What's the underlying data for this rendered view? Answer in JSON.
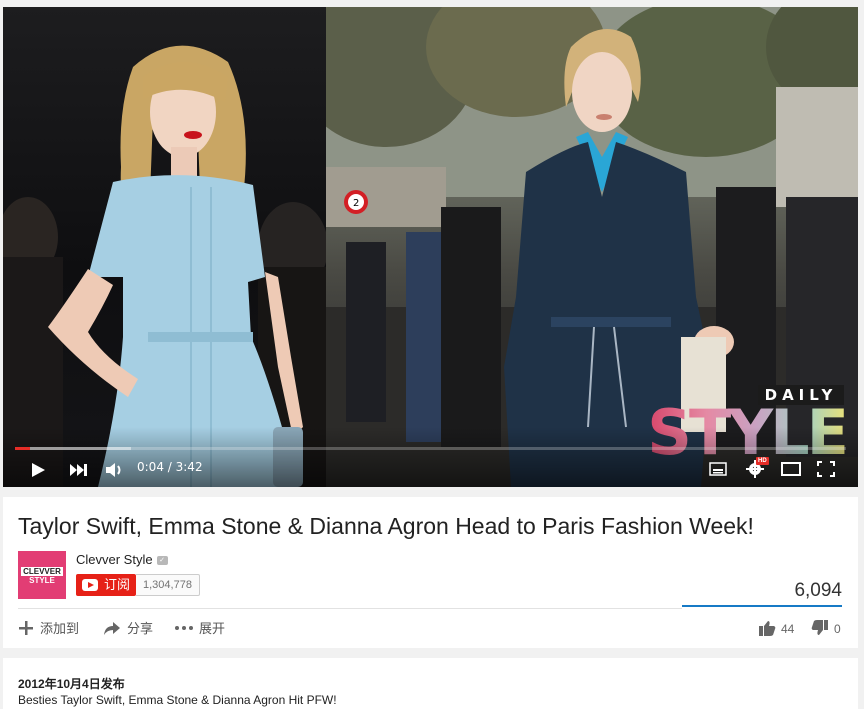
{
  "video": {
    "current_time": "0:04",
    "separator": " / ",
    "duration": "3:42",
    "played_fraction": 0.018,
    "loaded_fraction": 0.14,
    "hd_badge": "HD",
    "watermark": {
      "daily": "DAILY",
      "style": "STYLE"
    },
    "sign_text": "2"
  },
  "info": {
    "title": "Taylor Swift, Emma Stone & Dianna Agron Head to Paris Fashion Week!",
    "channel": {
      "name": "Clevver Style",
      "avatar_line1": "CLEVVER",
      "avatar_line2": "STYLE"
    },
    "subscribe_label": "订阅",
    "subscriber_count": "1,304,778",
    "view_count": "6,094",
    "actions": {
      "add_to": "添加到",
      "share": "分享",
      "more": "展开"
    },
    "likes": "44",
    "dislikes": "0"
  },
  "description": {
    "published": "2012年10月4日发布",
    "text": "Besties Taylor Swift, Emma Stone & Dianna Agron Hit PFW!"
  },
  "colors": {
    "accent_red": "#e62117",
    "progress_red": "#e52d27",
    "views_blue": "#167ac6",
    "avatar_pink": "#e23d74"
  },
  "icons": {
    "play": "play-icon",
    "next": "next-icon",
    "volume": "volume-icon",
    "subtitles": "subtitles-icon",
    "settings": "gear-icon",
    "theater": "theater-mode-icon",
    "fullscreen": "fullscreen-icon",
    "add": "plus-icon",
    "share": "share-arrow-icon",
    "more": "more-dots-icon",
    "like": "thumbs-up-icon",
    "dislike": "thumbs-down-icon"
  }
}
